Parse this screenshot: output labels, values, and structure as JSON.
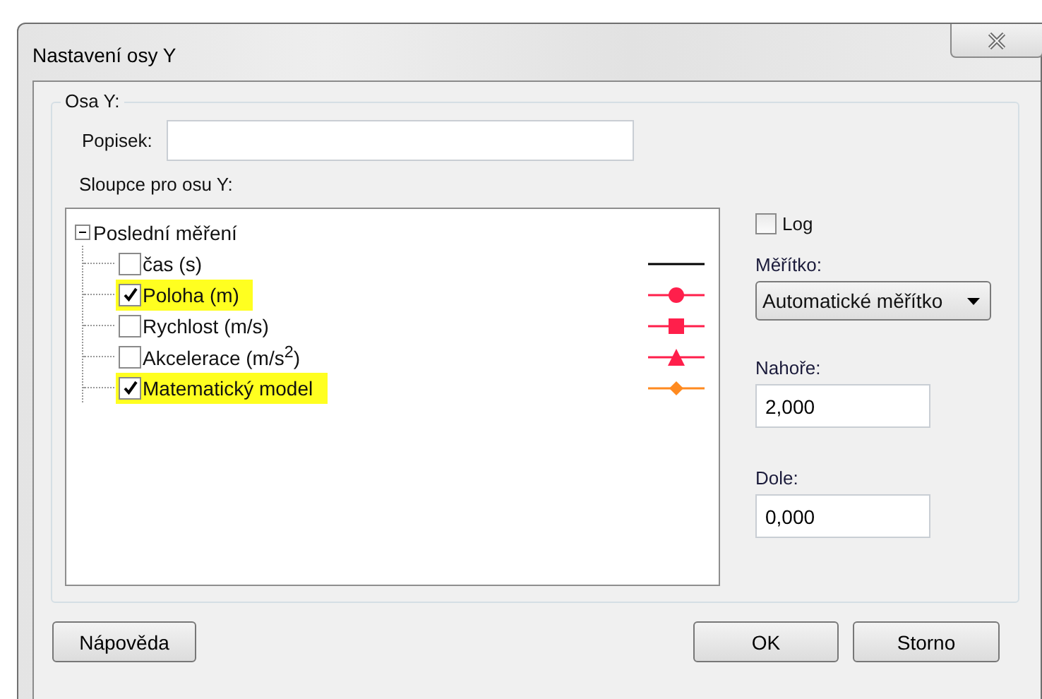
{
  "window": {
    "title": "Nastavení osy Y"
  },
  "group": {
    "title": "Osa Y:",
    "label_field": {
      "label": "Popisek:"
    },
    "columns_label": "Sloupce pro osu Y:",
    "tree": {
      "label": "Poslední měření",
      "expanded": true,
      "children": [
        {
          "label": "čas (s)",
          "checked": false,
          "highlighted": false,
          "kind": "line",
          "color": "#000000"
        },
        {
          "label": "Poloha (m)",
          "checked": true,
          "highlighted": true,
          "kind": "circle",
          "color": "#ff1f4b"
        },
        {
          "label": "Rychlost (m/s)",
          "checked": false,
          "highlighted": false,
          "kind": "square",
          "color": "#ff1f4b"
        },
        {
          "label": "Akcelerace (m/s$^{2}$)",
          "checked": false,
          "highlighted": false,
          "kind": "triangle",
          "color": "#ff1f4b"
        },
        {
          "label": "Matematický model",
          "checked": true,
          "highlighted": true,
          "kind": "diamond",
          "color": "#ff8a1f"
        }
      ]
    },
    "log": {
      "label": "Log",
      "checked": false
    },
    "scale": {
      "label": "Měřítko:",
      "value": "Automatické měřítko"
    },
    "top": {
      "label": "Nahoře:",
      "value": "2,000"
    },
    "bottom": {
      "label": "Dole:",
      "value": "0,000"
    }
  },
  "buttons": {
    "help": "Nápověda",
    "ok": "OK",
    "cancel": "Storno"
  }
}
